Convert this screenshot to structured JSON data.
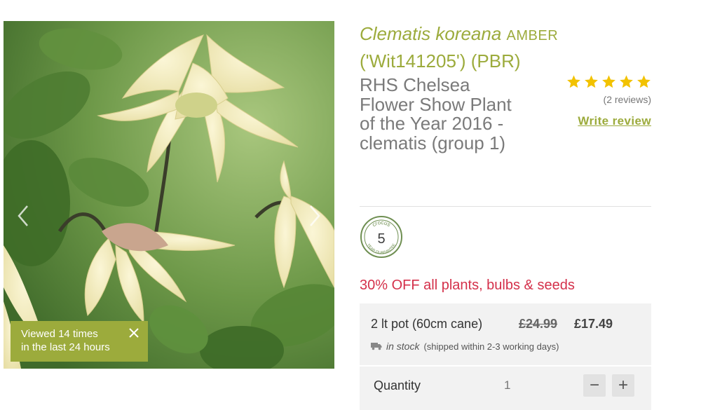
{
  "product": {
    "latin_name": "Clematis koreana",
    "cultivar": "AMBER",
    "code_line": "('Wit141205') (PBR)",
    "subtitle": "RHS Chelsea Flower Show Plant of the Year 2016 - clematis (group 1)"
  },
  "rating": {
    "stars": 5,
    "review_count": "(2 reviews)",
    "write_review_label": "Write review"
  },
  "guarantee": {
    "brand": "crocus",
    "years": "5",
    "text": "YEAR GUARANTEE"
  },
  "promo": "30% OFF all plants, bulbs & seeds",
  "offer": {
    "variant": "2 lt pot (60cm cane)",
    "old_price": "£24.99",
    "new_price": "£17.49",
    "stock_status": "in stock",
    "shipping_note": "(shipped within 2-3 working days)"
  },
  "quantity": {
    "label": "Quantity",
    "value": "1",
    "minus": "−",
    "plus": "+"
  },
  "viewed_badge": {
    "line1": "Viewed 14 times",
    "line2": "in the last 24 hours"
  },
  "colors": {
    "brand_green": "#9cab3c",
    "promo_red": "#d4304a",
    "star_yellow": "#f2c200"
  },
  "icons": {
    "prev": "chevron-left-icon",
    "next": "chevron-right-icon",
    "close": "close-icon",
    "truck": "truck-icon",
    "star": "star-icon"
  }
}
